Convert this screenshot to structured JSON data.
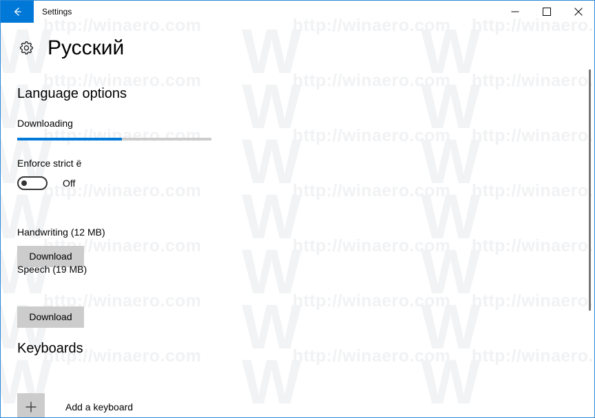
{
  "window": {
    "titlebar": {
      "back_icon": "back-arrow-icon",
      "title": "Settings",
      "minimize_label": "—",
      "maximize_label": "□",
      "close_label": "✕"
    },
    "accent_color": "#0078d7",
    "border_color": "#2b88d8",
    "background_color": "#ffffff"
  },
  "page": {
    "icon": "gear-icon",
    "title": "Русский"
  },
  "language_options": {
    "heading": "Language options",
    "download_status": {
      "label": "Downloading",
      "progress_percent": 54,
      "fill_color": "#0078d7",
      "track_color": "#cccccc"
    },
    "enforce_strict": {
      "label": "Enforce strict ё",
      "state": "Off",
      "checked": false
    },
    "features": [
      {
        "label": "Handwriting (12 MB)",
        "button_label": "Download"
      },
      {
        "label": "Speech (19 MB)",
        "button_label": "Download"
      }
    ]
  },
  "keyboards": {
    "heading": "Keyboards",
    "add_keyboard": {
      "icon": "plus-icon",
      "label": "Add a keyboard"
    }
  },
  "watermark": {
    "url_text": "http://winaero.com",
    "logo_text": "W",
    "color": "#f1f2f4"
  }
}
